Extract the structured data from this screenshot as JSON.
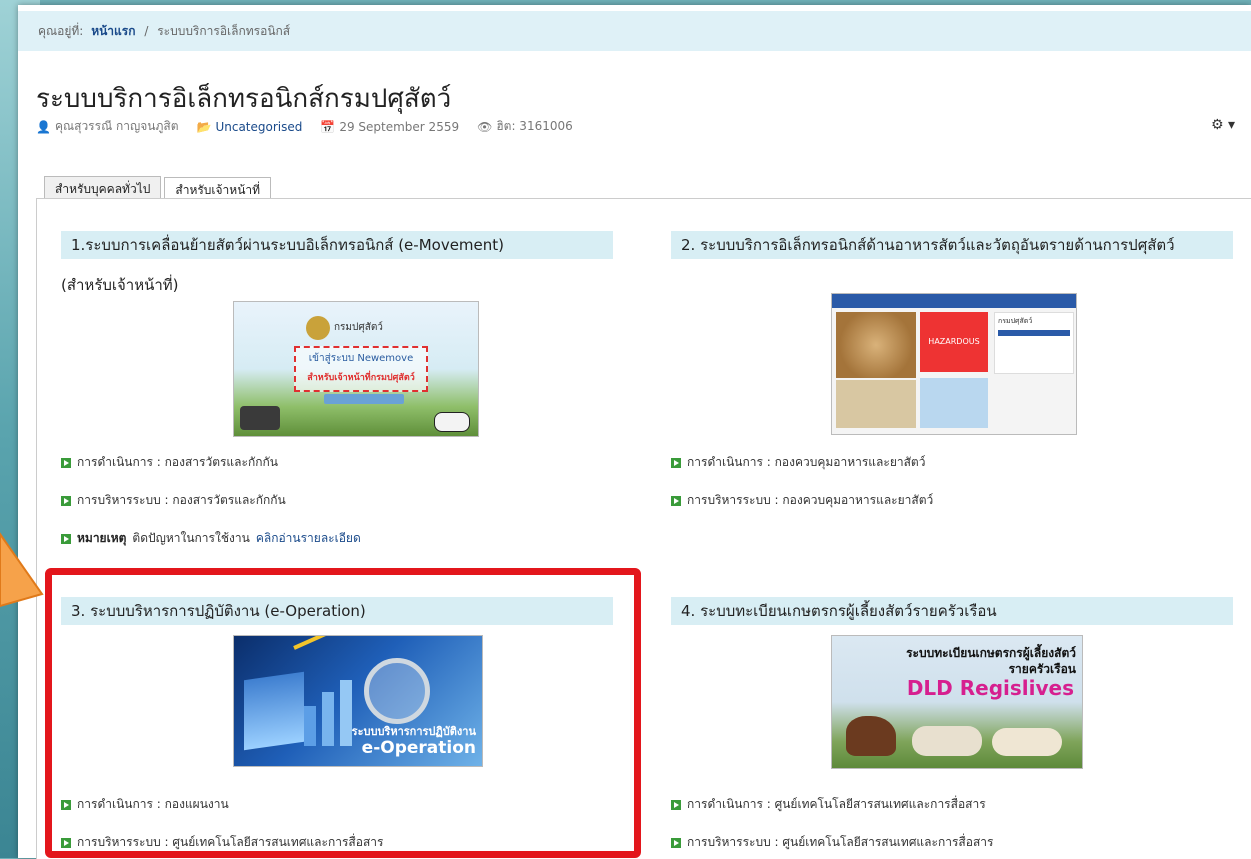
{
  "breadcrumb": {
    "prefix": "คุณอยู่ที่:",
    "home": "หน้าแรก",
    "current": "ระบบบริการอิเล็กทรอนิกส์"
  },
  "page_title": "ระบบบริการอิเล็กทรอนิกส์กรมปศุสัตว์",
  "meta": {
    "author": "คุณสุวรรณี กาญจนภูสิต",
    "category": "Uncategorised",
    "date": "29 September 2559",
    "hits": "ฮิต: 3161006"
  },
  "tabs": [
    {
      "label": "สำหรับบุคคลทั่วไป"
    },
    {
      "label": "สำหรับเจ้าหน้าที่"
    }
  ],
  "cards": [
    {
      "title": "1.ระบบการเคลื่อนย้ายสัตว์ผ่านระบบอิเล็กทรอนิกส์ (e-Movement)",
      "subnote": "(สำหรับเจ้าหน้าที่)",
      "image_text": [
        "กรมปศุสัตว์",
        "เข้าสู่ระบบ Newemove",
        "สำหรับเจ้าหน้าที่กรมปศุสัตว์"
      ],
      "lines": [
        "การดำเนินการ : กองสารวัตรและกักกัน",
        "การบริหารระบบ : กองสารวัตรและกักกัน"
      ],
      "note_label": "หมายเหตุ",
      "note_text": "ติดปัญหาในการใช้งาน",
      "note_link": "คลิกอ่านรายละเอียด"
    },
    {
      "title": "2. ระบบบริการอิเล็กทรอนิกส์ด้านอาหารสัตว์และวัตถุอันตรายด้านการปศุสัตว์",
      "image_text": [
        "HAZARDOUS",
        "กรมปศุสัตว์"
      ],
      "lines": [
        "การดำเนินการ : กองควบคุมอาหารและยาสัตว์",
        "การบริหารระบบ : กองควบคุมอาหารและยาสัตว์"
      ]
    },
    {
      "title": "3. ระบบบริหารการปฏิบัติงาน (e-Operation)",
      "image_text": [
        "ระบบบริหารการปฏิบัติงาน",
        "e-Operation"
      ],
      "lines": [
        "การดำเนินการ : กองแผนงาน",
        "การบริหารระบบ : ศูนย์เทคโนโลยีสารสนเทศและการสื่อสาร"
      ]
    },
    {
      "title": "4. ระบบทะเบียนเกษตรกรผู้เลี้ยงสัตว์รายครัวเรือน",
      "image_text": [
        "ระบบทะเบียนเกษตรกรผู้เลี้ยงสัตว์",
        "รายครัวเรือน",
        "DLD Regislives"
      ],
      "lines": [
        "การดำเนินการ : ศูนย์เทคโนโลยีสารสนเทศและการสื่อสาร",
        "การบริหารระบบ : ศูนย์เทคโนโลยีสารสนเทศและการสื่อสาร"
      ]
    }
  ],
  "colors": {
    "title_bg": "#d8eef4",
    "highlight": "#e3161c",
    "bullet": "#3a9b3a",
    "link": "#1a4a8a"
  }
}
